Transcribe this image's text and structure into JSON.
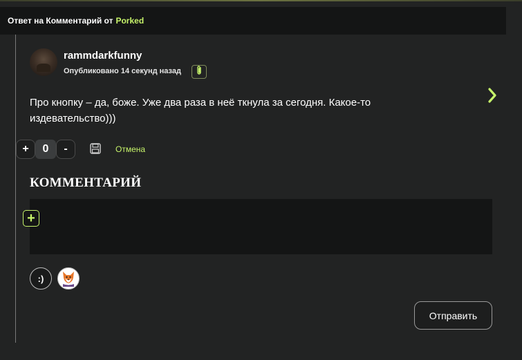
{
  "reply_bar": {
    "prefix": "Ответ на Комментарий от",
    "author": "Porked"
  },
  "comment": {
    "username": "rammdarkfunny",
    "published": "Опубликовано 14 секунд назад",
    "text": "Про кнопку – да, боже. Уже два раза в неё ткнула за сегодня. Какое-то издевательство)))",
    "attachment_icon": "paperclip-icon",
    "next_icon": "chevron-right-icon"
  },
  "votes": {
    "plus_label": "+",
    "count": "0",
    "minus_label": "-"
  },
  "actions": {
    "save_icon": "floppy-disk-icon",
    "cancel_label": "Отмена"
  },
  "editor": {
    "heading": "КОММЕНТАРИЙ",
    "add_label": "+",
    "emoji_label": ":)",
    "sticker_icon": "fox-sticker-icon",
    "submit_label": "Отправить"
  },
  "colors": {
    "accent": "#c6f36a",
    "background": "#222323",
    "panel": "#141515"
  }
}
